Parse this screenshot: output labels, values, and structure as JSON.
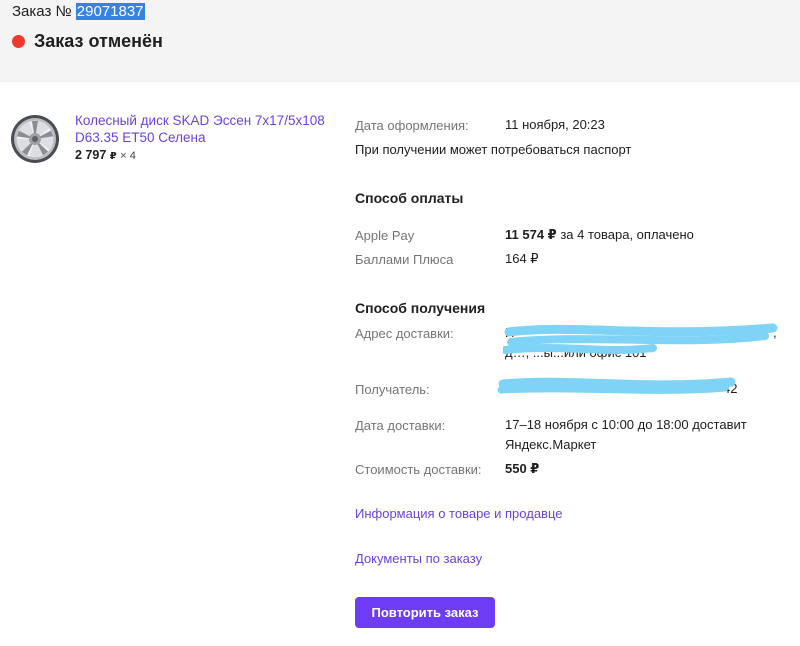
{
  "header": {
    "order_label": "Заказ №",
    "order_id": "29071837",
    "status": "Заказ отменён",
    "status_color": "#f0392c"
  },
  "product": {
    "icon": "wheel-rim-icon",
    "title": "Колесный диск SKAD Эссен 7x17/5x108 D63.35 ET50 Селена",
    "price": "2 797",
    "currency": "₽",
    "quantity": "× 4"
  },
  "order_info": {
    "date_label": "Дата оформления:",
    "date_value": "11 ноября, 20:23",
    "passport_note": "При получении может потребоваться паспорт"
  },
  "payment": {
    "title": "Способ оплаты",
    "rows": [
      {
        "label": "Apple Pay",
        "amount": "11 574 ₽",
        "note": " за 4 товара, оплачено"
      },
      {
        "label": "Баллами Плюса",
        "amount": "164 ₽"
      }
    ]
  },
  "delivery": {
    "title": "Способ получения",
    "address_label": "Адрес доставки:",
    "address_visible_start": "Н",
    "address_line2": "д…, ...ы...или офис 101",
    "address_end": ",",
    "recipient_label": "Получатель:",
    "recipient_visible_end": "42",
    "date_label": "Дата доставки:",
    "date_value": "17–18 ноября с 10:00 до 18:00 доставит Яндекс.Маркет",
    "cost_label": "Стоимость доставки:",
    "cost_value": "550 ₽"
  },
  "links": {
    "product_info": "Информация о товаре и продавце",
    "documents": "Документы по заказу"
  },
  "actions": {
    "repeat_order": "Повторить заказ"
  },
  "colors": {
    "accent": "#6e3cf5",
    "link": "#6b43d6",
    "redaction": "#7fd3f7",
    "selection": "#3584e4"
  }
}
